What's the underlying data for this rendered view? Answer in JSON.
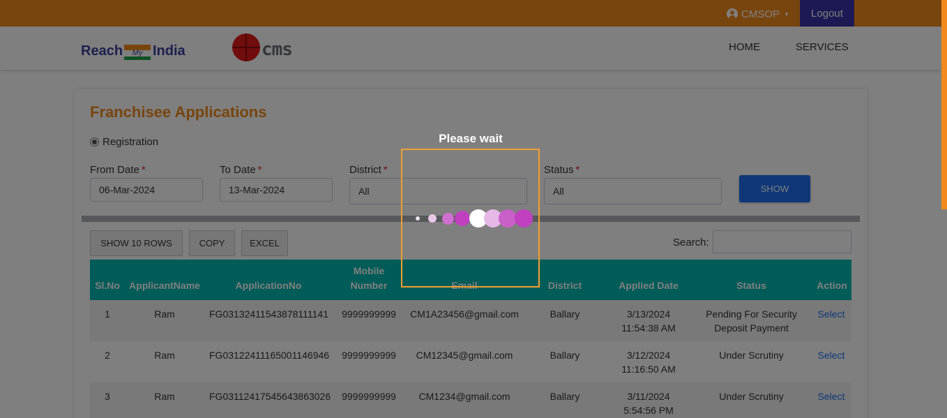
{
  "topbar": {
    "user_label": "CMSOP",
    "logout_label": "Logout"
  },
  "header": {
    "logo_reach": "Reach",
    "logo_my": "My",
    "logo_india": "India",
    "logo_cms": "cms",
    "nav": [
      "HOME",
      "SERVICES"
    ]
  },
  "page": {
    "title": "Franchisee Applications",
    "radio_label": "Registration",
    "filters": {
      "from_date_label": "From Date",
      "from_date_value": "06-Mar-2024",
      "to_date_label": "To Date",
      "to_date_value": "13-Mar-2024",
      "district_label": "District",
      "district_value": "All",
      "status_label": "Status",
      "status_value": "All",
      "required_mark": "*",
      "show_label": "SHOW"
    },
    "toolbar": {
      "show_rows_label": "SHOW 10 ROWS",
      "copy_label": "COPY",
      "excel_label": "EXCEL",
      "search_label": "Search:"
    },
    "table": {
      "headers": [
        "Sl.No",
        "ApplicantName",
        "ApplicationNo",
        "Mobile\nNumber",
        "Email",
        "District",
        "Applied Date",
        "Status",
        "Action"
      ],
      "rows": [
        {
          "sl": "1",
          "name": "Ram",
          "app_no": "FG03132411543878111141",
          "mobile": "9999999999",
          "email": "CM1A23456@gmail.com",
          "district": "Ballary",
          "date": "3/13/2024\n11:54:38 AM",
          "status": "Pending For Security\nDeposit Payment",
          "action": "Select"
        },
        {
          "sl": "2",
          "name": "Ram",
          "app_no": "FG03122411165001146946",
          "mobile": "9999999999",
          "email": "CM12345@gmail.com",
          "district": "Ballary",
          "date": "3/12/2024\n11:16:50 AM",
          "status": "Under Scrutiny",
          "action": "Select"
        },
        {
          "sl": "3",
          "name": "Ram",
          "app_no": "FG03112417545643863026",
          "mobile": "9999999999",
          "email": "CM1234@gmail.com",
          "district": "Ballary",
          "date": "3/11/2024\n5:54:56 PM",
          "status": "Under Scrutiny",
          "action": "Select"
        }
      ]
    }
  },
  "loader": {
    "text": "Please wait",
    "colors": {
      "accent": "#f08a1c",
      "dot": "#c040c0",
      "dot_light": "#e6b8e6",
      "box_border": "#f0a030"
    }
  }
}
